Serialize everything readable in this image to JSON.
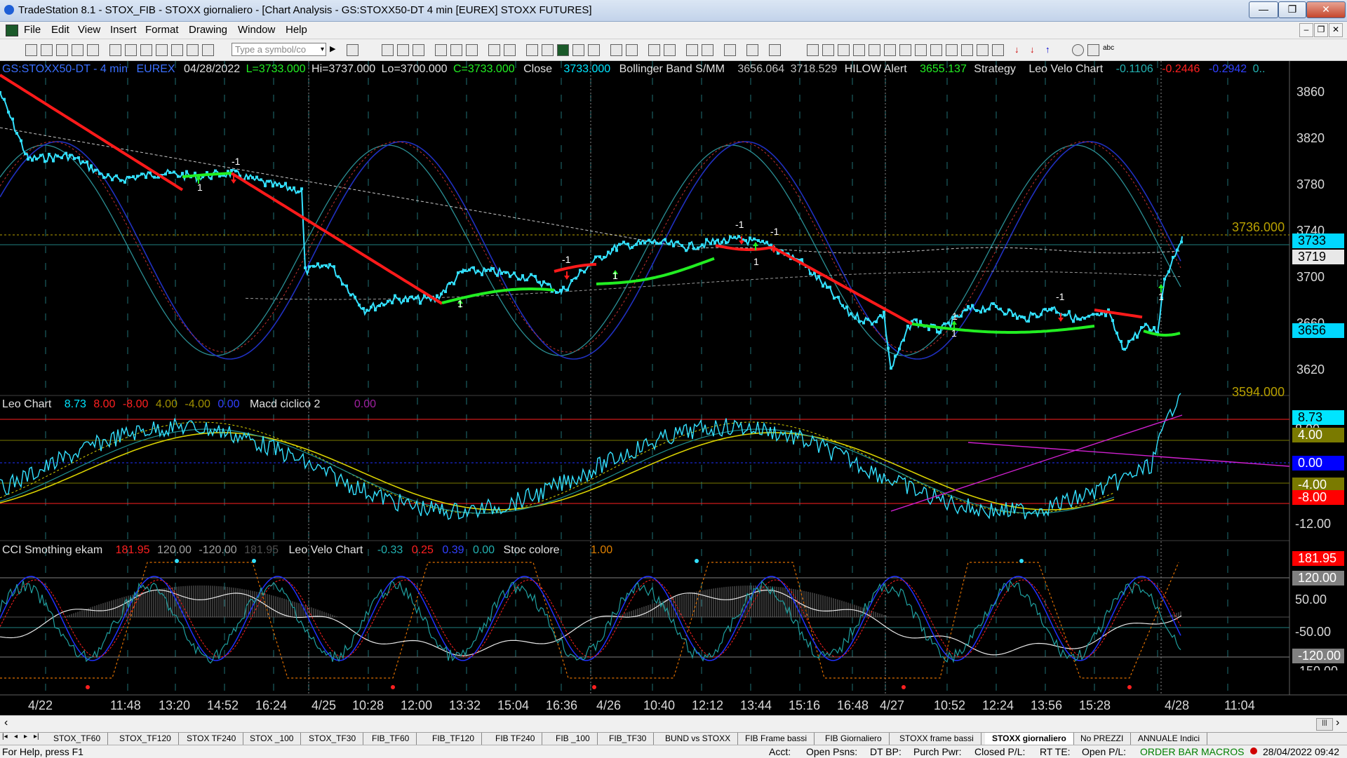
{
  "window": {
    "title": "TradeStation 8.1 - STOX_FIB - STOXX giornaliero - [Chart Analysis - GS:STOXX50-DT  4 min  [EUREX] STOXX FUTURES]",
    "minimize": "—",
    "maximize": "❐",
    "close": "✕"
  },
  "menu": {
    "items": [
      "File",
      "Edit",
      "View",
      "Insert",
      "Format",
      "Drawing",
      "Window",
      "Help"
    ],
    "sub_minimize": "–",
    "sub_restore": "❐",
    "sub_close": "✕"
  },
  "toolbar": {
    "symbol_placeholder": "Type a symbol/co",
    "dropdown_arrow": "▾"
  },
  "price_pane": {
    "header": {
      "symbol": "GS:STOXX50-DT - 4 min",
      "exchange": "EUREX",
      "date": "04/28/2022",
      "last": "L=3733.000",
      "high": "Hi=3737.000",
      "low": "Lo=3700.000",
      "close_eq": "C=3733.000",
      "close_label": "Close",
      "close_value": "3733.000",
      "bb_label": "Bollinger Band S/MM",
      "bb_v1": "3656.064",
      "bb_v2": "3718.529",
      "hilow_label": "HILOW Alert",
      "hilow_value": "3655.137",
      "strategy_label": "Strategy",
      "leo_label": "Leo Velo Chart",
      "leo_v1": "-0.1106",
      "leo_v2": "-0.2446",
      "leo_v3": "-0.2942",
      "leo_v4": "0.."
    },
    "scale": [
      "3860",
      "3820",
      "3780",
      "3740",
      "3700",
      "3660",
      "3620"
    ],
    "level_high": "3736.000",
    "level_low": "3594.000",
    "tags": [
      {
        "text": "3733",
        "color": "#00d8ff"
      },
      {
        "text": "3719",
        "color": "#e8e8e8"
      },
      {
        "text": "3656",
        "color": "#00d8ff"
      }
    ],
    "markers": [
      "1",
      "-1",
      "1",
      "-1",
      "1",
      "-1",
      "1",
      "-1",
      "1",
      "1",
      "-1",
      "1"
    ]
  },
  "macd_pane": {
    "header": {
      "name": "Leo Chart",
      "v1": "8.73",
      "v2": "8.00",
      "v3": "-8.00",
      "v4": "4.00",
      "v5": "-4.00",
      "v6": "0.00",
      "name2": "Macd ciclico 2",
      "v7": "0.00"
    },
    "scale": [
      "8.00",
      "-8.00",
      "-12.00"
    ],
    "tags": [
      {
        "text": "8.73",
        "bg": "#00e5ff",
        "fg": "#000"
      },
      {
        "text": "4.00",
        "bg": "#7a7a00",
        "fg": "#fff"
      },
      {
        "text": "0.00",
        "bg": "#0000ff",
        "fg": "#fff"
      },
      {
        "text": "-4.00",
        "bg": "#7a7a00",
        "fg": "#fff"
      },
      {
        "text": "-8.00",
        "bg": "#ff0000",
        "fg": "#fff"
      }
    ]
  },
  "cci_pane": {
    "header": {
      "name": "CCI Smothing ekam",
      "v1": "181.95",
      "v2": "120.00",
      "v3": "-120.00",
      "v4": "181.95",
      "name2": "Leo Velo Chart",
      "v5": "-0.33",
      "v6": "0.25",
      "v7": "0.39",
      "v8": "0.00",
      "name3": "Stoc colore",
      "v9": "1.00"
    },
    "scale": [
      "50.00",
      "-50.00",
      "-150.00"
    ],
    "tags": [
      {
        "text": "181.95",
        "bg": "#ff0000",
        "fg": "#fff"
      },
      {
        "text": "120.00",
        "bg": "#808080",
        "fg": "#fff"
      },
      {
        "text": "-120.00",
        "bg": "#808080",
        "fg": "#fff"
      }
    ]
  },
  "time_axis": [
    "4/22",
    "11:48",
    "13:20",
    "14:52",
    "16:24",
    "4/25",
    "10:28",
    "12:00",
    "13:32",
    "15:04",
    "16:36",
    "4/26",
    "10:40",
    "12:12",
    "13:44",
    "15:16",
    "16:48",
    "4/27",
    "10:52",
    "12:24",
    "13:56",
    "15:28",
    "4/28",
    "11:04"
  ],
  "scroll": {
    "left": "‹",
    "right": "›",
    "thumb": "|||"
  },
  "tab_nav": [
    "|◂",
    "◂",
    "▸",
    "▸|"
  ],
  "tabs": [
    "STOX_TF60",
    "STOX_TF120",
    "STOX TF240",
    "STOX _100",
    "STOX_TF30",
    "FIB_TF60",
    "FIB_TF120",
    "FIB TF240",
    "FIB _100",
    "FIB_TF30",
    "BUND vs STOXX",
    "FIB Frame bassi",
    "FIB Giornaliero",
    "STOXX frame bassi",
    "STOXX giornaliero",
    "No PREZZI",
    "ANNUALE Indici"
  ],
  "active_tab": "STOXX giornaliero",
  "status": {
    "help": "For Help, press F1",
    "acct": "Acct:",
    "open_psns": "Open Psns:",
    "dt_bp": "DT BP:",
    "purch_pwr": "Purch Pwr:",
    "closed_pl": "Closed P/L:",
    "rt_te": "RT TE:",
    "open_pl": "Open P/L:",
    "order_bar": "ORDER BAR",
    "macros": "MACROS",
    "datetime": "28/04/2022 09:42"
  },
  "colors": {
    "background": "#000000",
    "price": "#33e0ff",
    "bollinger_outer": "#2a8f94",
    "bollinger_blue": "#2030c0",
    "ma_red": "#ff1a1a",
    "ma_green": "#22ee22",
    "yellow": "#d8d000",
    "magenta": "#d020d0",
    "gold_text": "#b8a000"
  }
}
